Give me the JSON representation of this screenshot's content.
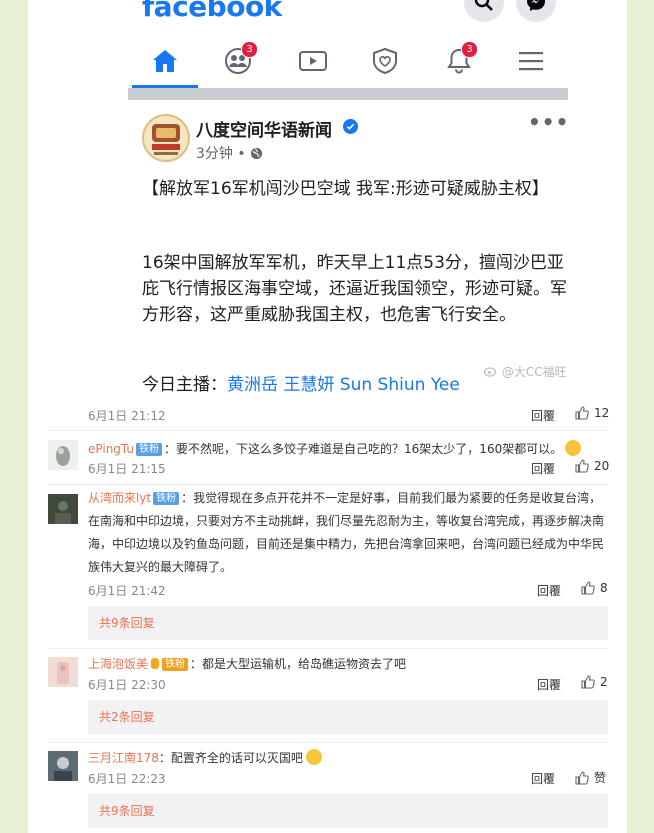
{
  "facebook": {
    "logo": "facebook",
    "nav": {
      "friends_badge": "3",
      "notifications_badge": "3"
    },
    "post": {
      "page_name": "八度空间华语新闻",
      "time": "3分钟 •",
      "headline": "【解放军16军机闯沙巴空域  我军:形迹可疑威胁主权】",
      "body": "16架中国解放军军机，昨天早上11点53分，擅闯沙巴亚庇飞行情报区海事空域，还逼近我国领空，形迹可疑。军方形容，这严重威胁我国主权，也危害飞行安全。",
      "cut_text": "今日主播：",
      "cut_link": "黄洲岳 王慧妍 Sun Shiun Yee",
      "watermark": "@大CC福旺"
    }
  },
  "main_post": {
    "time": "6月1日 21:12",
    "reply_label": "回覆",
    "likes": "12"
  },
  "comments": [
    {
      "user": "ePingTu",
      "badge": "铁粉",
      "text": "：要不然呢，下这么多饺子难道是自己吃的？16架太少了，160架都可以。",
      "time": "6月1日 21:15",
      "reply_label": "回覆",
      "likes": "20",
      "more_replies": ""
    },
    {
      "user": "从湾而来lyt",
      "badge": "铁粉",
      "text": "：我觉得现在多点开花并不一定是好事，目前我们最为紧要的任务是收复台湾，在南海和中印边境，只要对方不主动挑衅，我们尽量先忍耐为主，等收复台湾完成，再逐步解决南海，中印边境以及钓鱼岛问题，目前还是集中精力，先把台湾拿回来吧，台湾问题已经成为中华民族伟大复兴的最大障碍了。",
      "time": "6月1日 21:42",
      "reply_label": "回覆",
      "likes": "8",
      "more_replies": "共9条回复"
    },
    {
      "user": "上海泡饭美",
      "badge": "铁粉",
      "text": "：都是大型运输机，给岛礁运物资去了吧",
      "time": "6月1日 22:30",
      "reply_label": "回覆",
      "likes": "2",
      "more_replies": "共2条回复"
    },
    {
      "user": "三月江南178",
      "badge": "",
      "text": "：配置齐全的话可以灭国吧",
      "time": "6月1日 22:23",
      "reply_label": "回覆",
      "likes": "赞",
      "more_replies": "共9条回复"
    }
  ]
}
